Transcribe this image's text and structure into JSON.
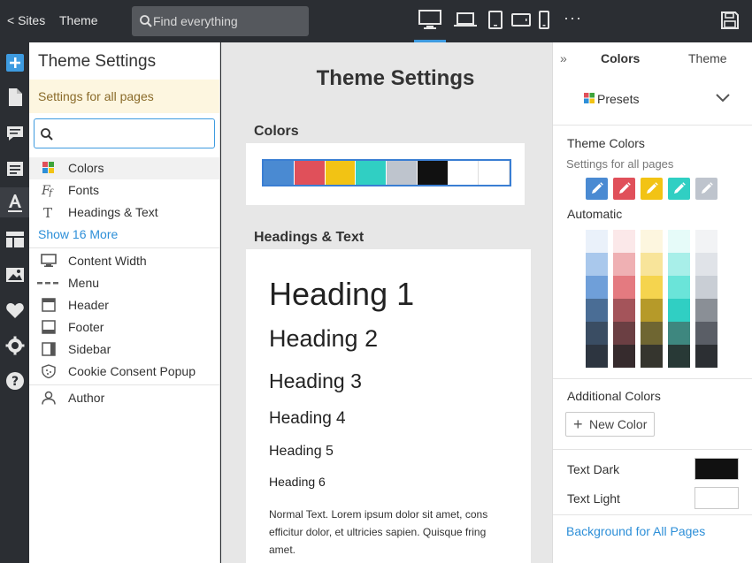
{
  "topbar": {
    "sites_label": "< Sites",
    "theme_label": "Theme",
    "search_placeholder": "Find everything",
    "more": "···"
  },
  "left_panel": {
    "title": "Theme Settings",
    "note": "Settings for all pages",
    "search_value": "",
    "items_group1": [
      {
        "label": "Colors",
        "icon": "colors-grid-icon",
        "selected": true
      },
      {
        "label": "Fonts",
        "icon": "fonts-icon"
      },
      {
        "label": "Headings & Text",
        "icon": "text-t-icon"
      }
    ],
    "show_more": "Show 16 More",
    "items_group2": [
      {
        "label": "Content Width",
        "icon": "monitor-icon"
      },
      {
        "label": "Menu",
        "icon": "menu-dashes-icon"
      },
      {
        "label": "Header",
        "icon": "header-layout-icon"
      },
      {
        "label": "Footer",
        "icon": "footer-layout-icon"
      },
      {
        "label": "Sidebar",
        "icon": "sidebar-layout-icon"
      },
      {
        "label": "Cookie Consent Popup",
        "icon": "cookie-shield-icon"
      }
    ],
    "items_group3": [
      {
        "label": "Author",
        "icon": "person-icon"
      }
    ]
  },
  "center": {
    "title": "Theme Settings",
    "colors_heading": "Colors",
    "swatches": [
      "#4a8ad2",
      "#e0505a",
      "#f2c314",
      "#30cfc3",
      "#bec4cd",
      "#111111",
      "#ffffff",
      "#ffffff"
    ],
    "headings_heading": "Headings & Text",
    "headings": [
      "Heading 1",
      "Heading 2",
      "Heading 3",
      "Heading 4",
      "Heading 5",
      "Heading 6"
    ],
    "paragraph_lines": [
      "Normal Text. Lorem ipsum dolor sit amet, cons",
      "efficitur dolor, et ultricies sapien. Quisque fring",
      "amet."
    ]
  },
  "right_panel": {
    "collapse": "»",
    "tab_colors": "Colors",
    "tab_theme": "Theme",
    "presets_label": "Presets",
    "theme_colors_label": "Theme Colors",
    "theme_colors_sub": "Settings for all pages",
    "theme_colors": [
      "#4a8ad2",
      "#e0505a",
      "#f2c314",
      "#30cfc3",
      "#bec4cd"
    ],
    "automatic_label": "Automatic",
    "shades": [
      [
        "#eaf1fa",
        "#a9c8ec",
        "#6f9fd9",
        "#4a6d95",
        "#3a4d63",
        "#2d3540"
      ],
      [
        "#fbe8e9",
        "#efb0b3",
        "#e47a80",
        "#a4545a",
        "#6b3f43",
        "#362b2d"
      ],
      [
        "#fdf6df",
        "#f8e49a",
        "#f5d44e",
        "#b69a29",
        "#6f6632",
        "#35352e"
      ],
      [
        "#e6fbf9",
        "#a8efe9",
        "#6ae4d9",
        "#30cfc3",
        "#3e877f",
        "#283936"
      ],
      [
        "#f2f3f5",
        "#e0e3e8",
        "#c9ced5",
        "#8a8f96",
        "#5a5e66",
        "#2c2f33"
      ]
    ],
    "additional_colors_label": "Additional Colors",
    "new_color_label": "New Color",
    "text_dark_label": "Text Dark",
    "text_dark_color": "#111111",
    "text_light_label": "Text Light",
    "text_light_color": "#ffffff",
    "background_link": "Background for All Pages"
  }
}
